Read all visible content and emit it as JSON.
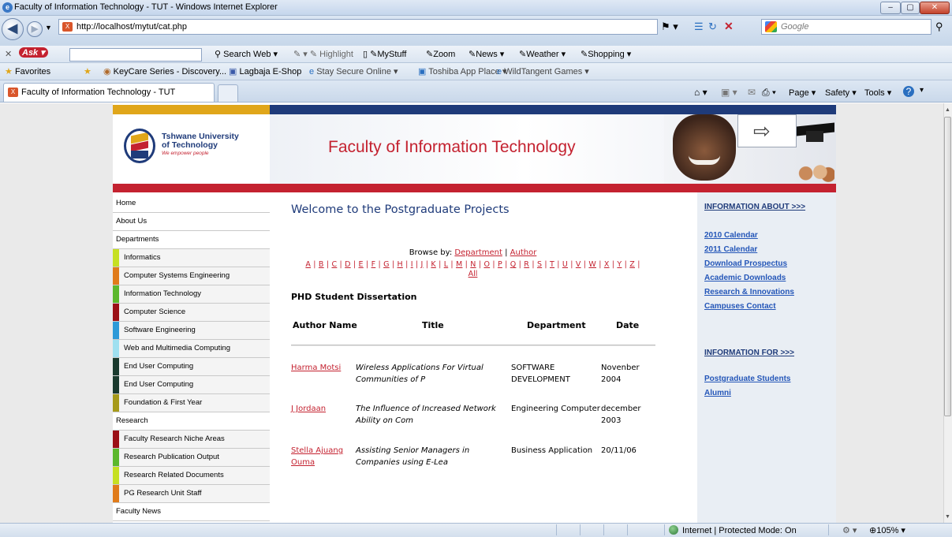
{
  "window": {
    "title": "Faculty of Information Technology - TUT - Windows Internet Explorer"
  },
  "browser": {
    "url": "http://localhost/mytut/cat.php",
    "search_placeholder": "Google",
    "tab_title": "Faculty of Information Technology - TUT",
    "ask_toolbar": {
      "search_web": "Search Web",
      "highlight": "Highlight",
      "mystuff": "MyStuff",
      "zoom": "Zoom",
      "news": "News",
      "weather": "Weather",
      "shopping": "Shopping"
    },
    "favorites": {
      "label": "Favorites",
      "items": [
        "KeyCare Series - Discovery...",
        "Lagbaja E-Shop",
        "Stay Secure Online",
        "Toshiba App Place",
        "WildTangent Games"
      ]
    },
    "commands": {
      "page": "Page",
      "safety": "Safety",
      "tools": "Tools"
    },
    "status": {
      "zone": "Internet | Protected Mode: On",
      "zoom": "105%"
    }
  },
  "site": {
    "university_line1": "Tshwane University",
    "university_line2": "of Technology",
    "tagline": "We empower people",
    "banner_title": "Faculty of Information Technology",
    "menu": [
      {
        "label": "Home",
        "sub": false,
        "color": ""
      },
      {
        "label": "About Us",
        "sub": false,
        "color": ""
      },
      {
        "label": "Departments",
        "sub": false,
        "color": ""
      },
      {
        "label": "Informatics",
        "sub": true,
        "color": "#c6e022"
      },
      {
        "label": "Computer Systems Engineering",
        "sub": true,
        "color": "#e07b1a"
      },
      {
        "label": "Information Technology",
        "sub": true,
        "color": "#5cb82c"
      },
      {
        "label": "Computer Science",
        "sub": true,
        "color": "#9b1016"
      },
      {
        "label": "Software Engineering",
        "sub": true,
        "color": "#2e9ad8"
      },
      {
        "label": "Web and Multimedia Computing",
        "sub": true,
        "color": "#9fe0f0"
      },
      {
        "label": "End User Computing",
        "sub": true,
        "color": "#1a3a2e"
      },
      {
        "label": "End User Computing",
        "sub": true,
        "color": "#1a3a2e"
      },
      {
        "label": "Foundation & First Year",
        "sub": true,
        "color": "#a69a1a"
      },
      {
        "label": "Research",
        "sub": false,
        "color": ""
      },
      {
        "label": "Faculty Research Niche Areas",
        "sub": true,
        "color": "#9b1016"
      },
      {
        "label": "Research Publication Output",
        "sub": true,
        "color": "#5cb82c"
      },
      {
        "label": "Research Related Documents",
        "sub": true,
        "color": "#c6e022"
      },
      {
        "label": "PG Research Unit Staff",
        "sub": true,
        "color": "#e07b1a"
      },
      {
        "label": "Faculty News",
        "sub": false,
        "color": ""
      }
    ],
    "main": {
      "welcome": "Welcome to the Postgraduate Projects",
      "browse_prefix": "Browse by:",
      "browse_department": "Department",
      "browse_sep": "|",
      "browse_author": "Author",
      "letters": [
        "A",
        "B",
        "C",
        "D",
        "E",
        "F",
        "G",
        "H",
        "I",
        "J",
        "K",
        "L",
        "M",
        "N",
        "O",
        "P",
        "Q",
        "R",
        "S",
        "T",
        "U",
        "V",
        "W",
        "X",
        "Y",
        "Z"
      ],
      "all_link": "All",
      "section_heading": "PHD Student Dissertation",
      "columns": {
        "author": "Author Name",
        "title": "Title",
        "department": "Department",
        "date": "Date"
      },
      "rows": [
        {
          "author": "Harma Motsi",
          "title": "Wireless Applications For Virtual Communities of P",
          "department": "SOFTWARE DEVELOPMENT",
          "date": "Novenber 2004"
        },
        {
          "author": "J Jordaan",
          "title": "The Influence of Increased Network Ability on Com",
          "department": "Engineering Computer",
          "date": "december 2003"
        },
        {
          "author": "Stella Ajuang Ouma",
          "title": "Assisting Senior Managers in Companies using E-Lea",
          "department": "Business Application",
          "date": "20/11/06"
        }
      ]
    },
    "right": {
      "info_about": "INFORMATION ABOUT >>>",
      "about_links": [
        "2010 Calendar",
        "2011 Calendar",
        "Download Prospectus",
        "Academic Downloads",
        "Research & Innovations",
        "Campuses Contact"
      ],
      "info_for": "INFORMATION FOR >>>",
      "for_links": [
        "Postgraduate Students",
        "Alumni"
      ]
    }
  }
}
